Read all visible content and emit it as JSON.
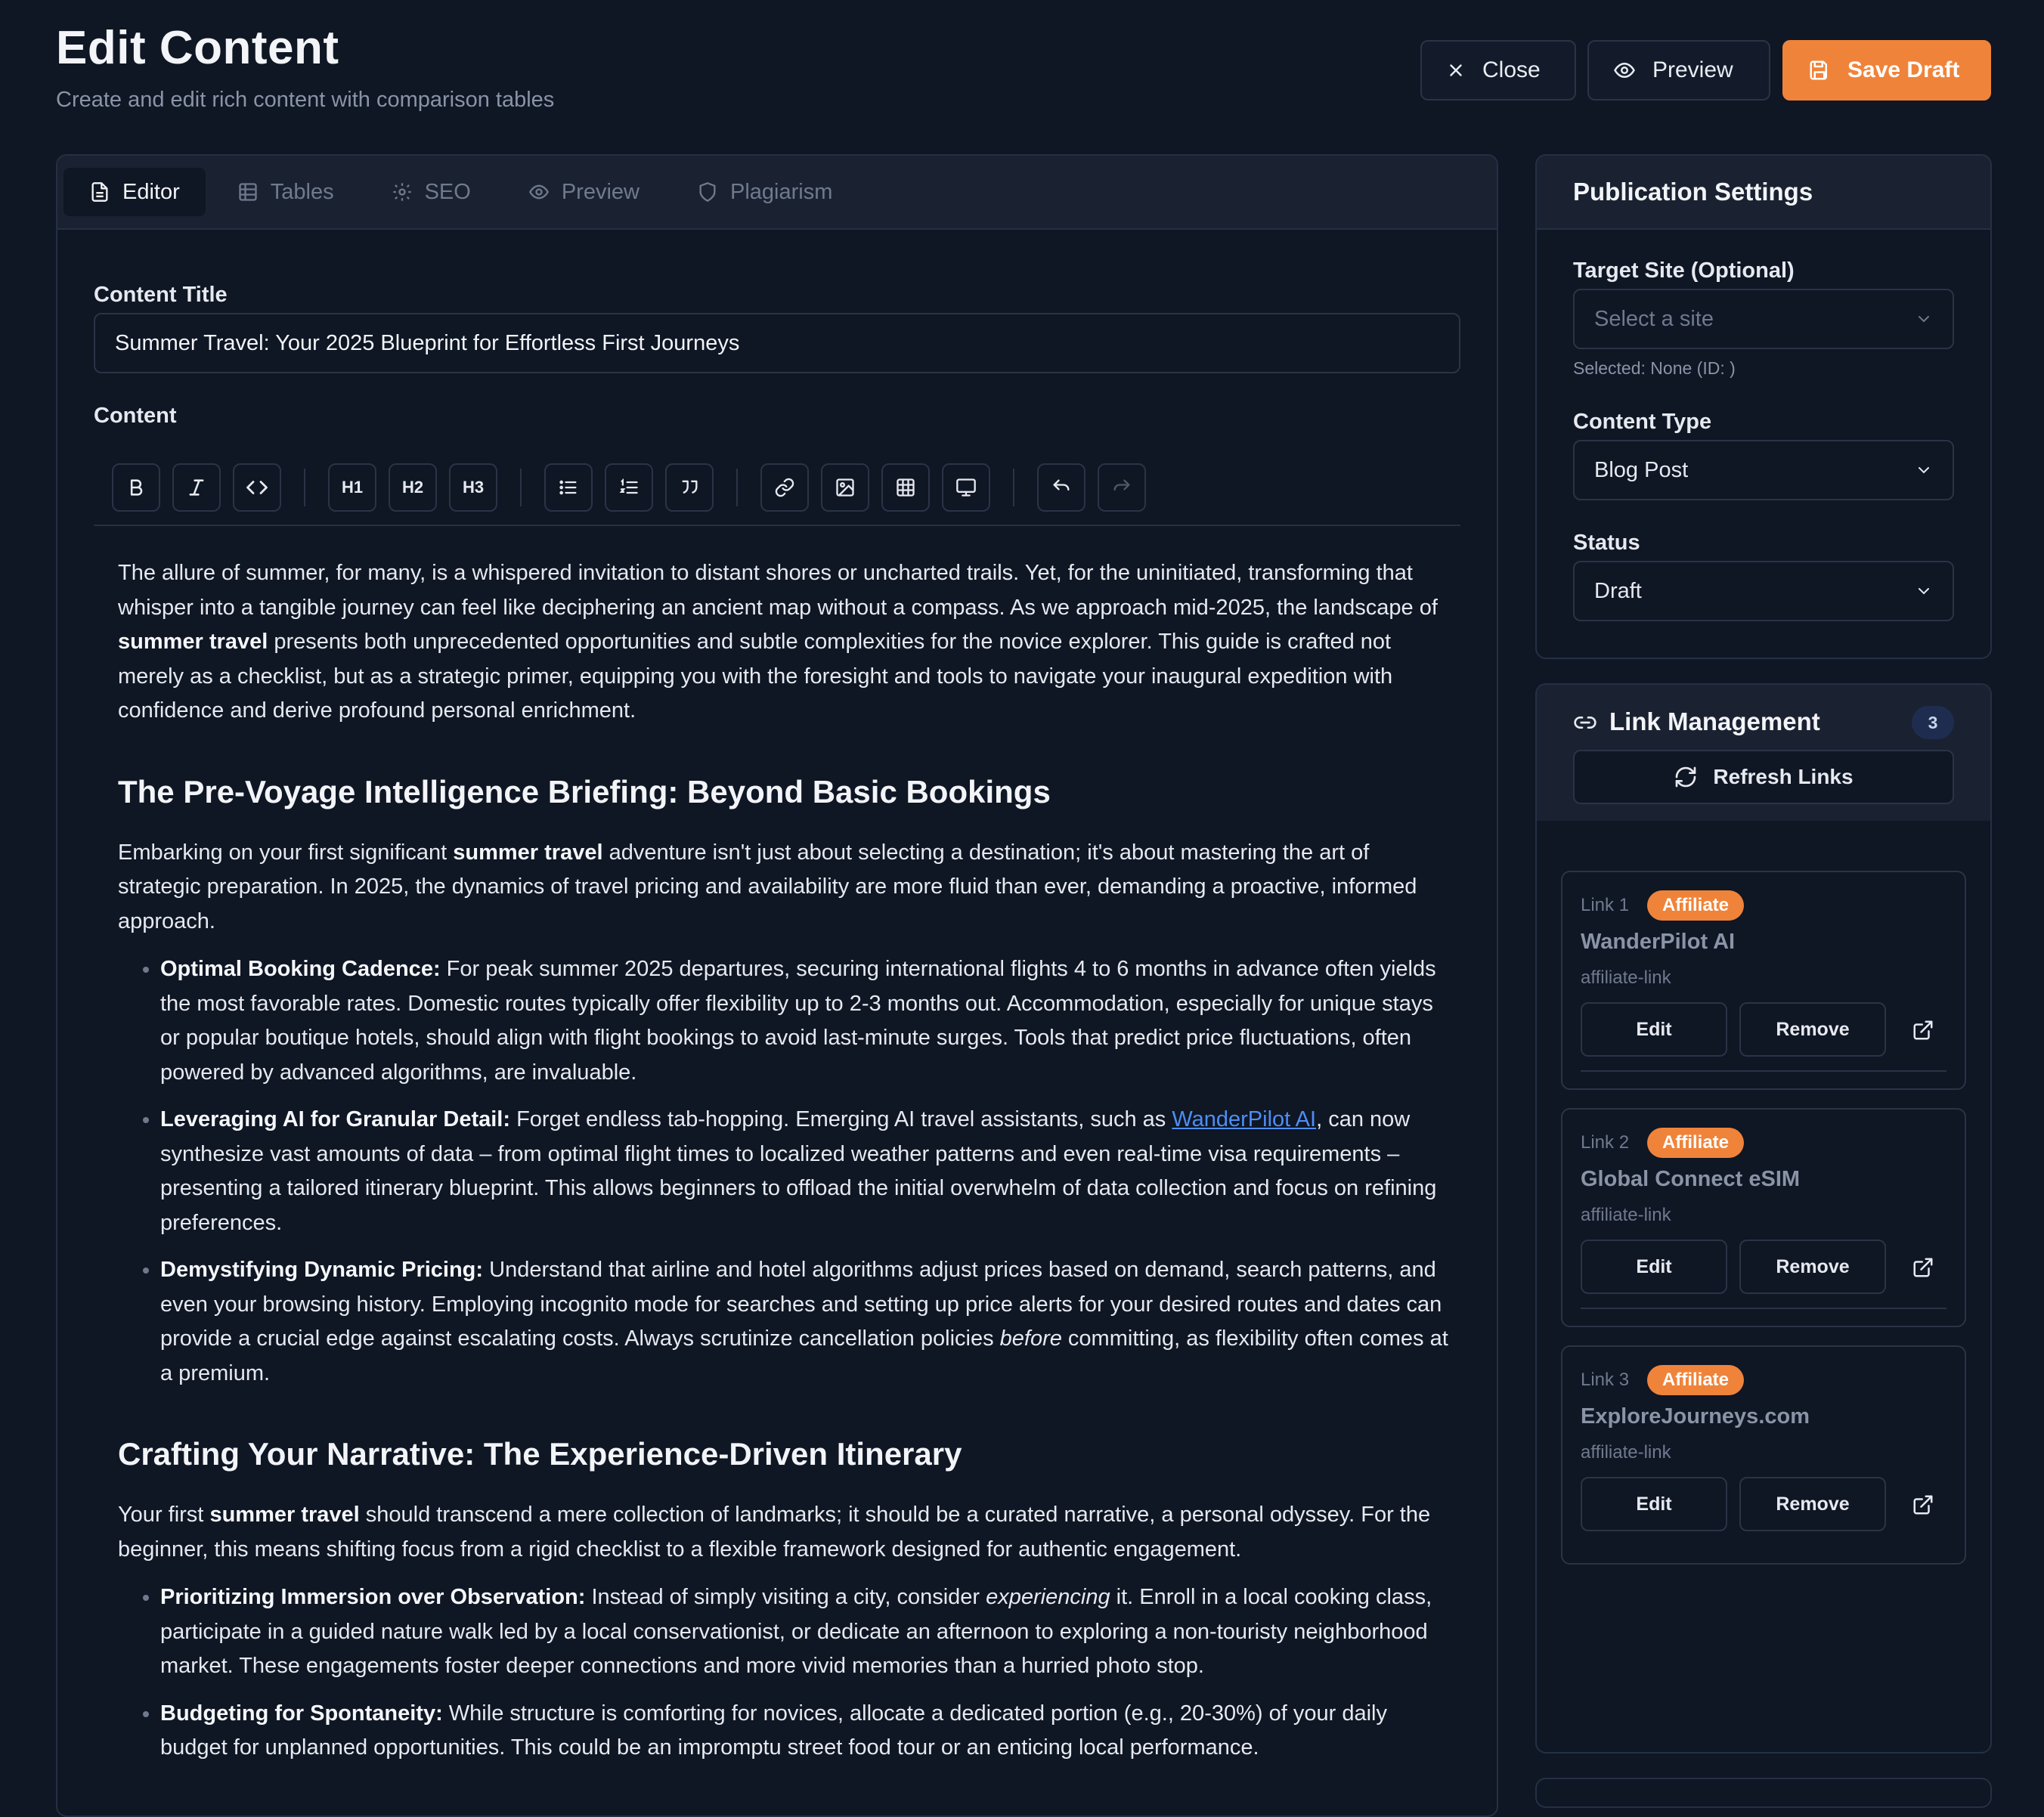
{
  "header": {
    "title": "Edit Content",
    "subtitle": "Create and edit rich content with comparison tables",
    "close_label": "Close",
    "preview_label": "Preview",
    "save_label": "Save Draft"
  },
  "tabs": [
    "Editor",
    "Tables",
    "SEO",
    "Preview",
    "Plagiarism"
  ],
  "editor": {
    "title_label": "Content Title",
    "title_value": "Summer Travel: Your 2025 Blueprint for Effortless First Journeys",
    "content_label": "Content",
    "toolbar": {
      "h1": "H1",
      "h2": "H2",
      "h3": "H3"
    }
  },
  "body": {
    "p1_a": "The allure of summer, for many, is a whispered invitation to distant shores or uncharted trails. Yet, for the uninitiated, transforming that whisper into a tangible journey can feel like deciphering an ancient map without a compass. As we approach mid-2025, the landscape of ",
    "p1_b": "summer travel",
    "p1_c": " presents both unprecedented opportunities and subtle complexities for the novice explorer. This guide is crafted not merely as a checklist, but as a strategic primer, equipping you with the foresight and tools to navigate your inaugural expedition with confidence and derive profound personal enrichment.",
    "h2_1": "The Pre-Voyage Intelligence Briefing: Beyond Basic Bookings",
    "p2_a": "Embarking on your first significant ",
    "p2_b": "summer travel",
    "p2_c": " adventure isn't just about selecting a destination; it's about mastering the art of strategic preparation. In 2025, the dynamics of travel pricing and availability are more fluid than ever, demanding a proactive, informed approach.",
    "li1_b": "Optimal Booking Cadence:",
    "li1_t": " For peak summer 2025 departures, securing international flights 4 to 6 months in advance often yields the most favorable rates. Domestic routes typically offer flexibility up to 2-3 months out. Accommodation, especially for unique stays or popular boutique hotels, should align with flight bookings to avoid last-minute surges. Tools that predict price fluctuations, often powered by advanced algorithms, are invaluable.",
    "li2_b": "Leveraging AI for Granular Detail:",
    "li2_t1": " Forget endless tab-hopping. Emerging AI travel assistants, such as ",
    "li2_link": "WanderPilot AI",
    "li2_t2": ", can now synthesize vast amounts of data – from optimal flight times to localized weather patterns and even real-time visa requirements – presenting a tailored itinerary blueprint. This allows beginners to offload the initial overwhelm of data collection and focus on refining preferences.",
    "li3_b": "Demystifying Dynamic Pricing:",
    "li3_t1": " Understand that airline and hotel algorithms adjust prices based on demand, search patterns, and even your browsing history. Employing incognito mode for searches and setting up price alerts for your desired routes and dates can provide a crucial edge against escalating costs. Always scrutinize cancellation policies ",
    "li3_i": "before",
    "li3_t2": " committing, as flexibility often comes at a premium.",
    "h2_2": "Crafting Your Narrative: The Experience-Driven Itinerary",
    "p3_a": "Your first ",
    "p3_b": "summer travel",
    "p3_c": " should transcend a mere collection of landmarks; it should be a curated narrative, a personal odyssey. For the beginner, this means shifting focus from a rigid checklist to a flexible framework designed for authentic engagement.",
    "li4_b": "Prioritizing Immersion over Observation:",
    "li4_t1": " Instead of simply visiting a city, consider ",
    "li4_i": "experiencing",
    "li4_t2": " it. Enroll in a local cooking class, participate in a guided nature walk led by a local conservationist, or dedicate an afternoon to exploring a non-touristy neighborhood market. These engagements foster deeper connections and more vivid memories than a hurried photo stop.",
    "li5_b": "Budgeting for Spontaneity:",
    "li5_t": " While structure is comforting for novices, allocate a dedicated portion (e.g., 20-30%) of your daily budget for unplanned opportunities. This could be an impromptu street food tour or an enticing local performance."
  },
  "publication": {
    "title": "Publication Settings",
    "site_label": "Target Site (Optional)",
    "site_placeholder": "Select a site",
    "site_hint": "Selected: None (ID: )",
    "type_label": "Content Type",
    "type_value": "Blog Post",
    "status_label": "Status",
    "status_value": "Draft"
  },
  "links": {
    "title": "Link Management",
    "count": "3",
    "refresh_label": "Refresh Links",
    "items": [
      {
        "no": "Link 1",
        "badge": "Affiliate",
        "name": "WanderPilot AI",
        "type": "affiliate-link",
        "edit": "Edit",
        "remove": "Remove"
      },
      {
        "no": "Link 2",
        "badge": "Affiliate",
        "name": "Global Connect eSIM",
        "type": "affiliate-link",
        "edit": "Edit",
        "remove": "Remove"
      },
      {
        "no": "Link 3",
        "badge": "Affiliate",
        "name": "ExploreJourneys.com",
        "type": "affiliate-link",
        "edit": "Edit",
        "remove": "Remove"
      }
    ]
  },
  "colors": {
    "background": "#0f1624",
    "panel": "#1a2232",
    "accent": "#f0833a",
    "link": "#4d8ef5",
    "count_badge": "#1e2d4f"
  },
  "icons": [
    "close-icon",
    "eye-icon",
    "save-icon",
    "document-icon",
    "table-icon",
    "gear-icon",
    "shield-icon",
    "bold-icon",
    "italic-icon",
    "code-icon",
    "bullet-list-icon",
    "numbered-list-icon",
    "quote-icon",
    "link-icon",
    "image-icon",
    "monitor-icon",
    "undo-icon",
    "redo-icon",
    "chevron-down-icon",
    "refresh-icon",
    "external-link-icon"
  ]
}
